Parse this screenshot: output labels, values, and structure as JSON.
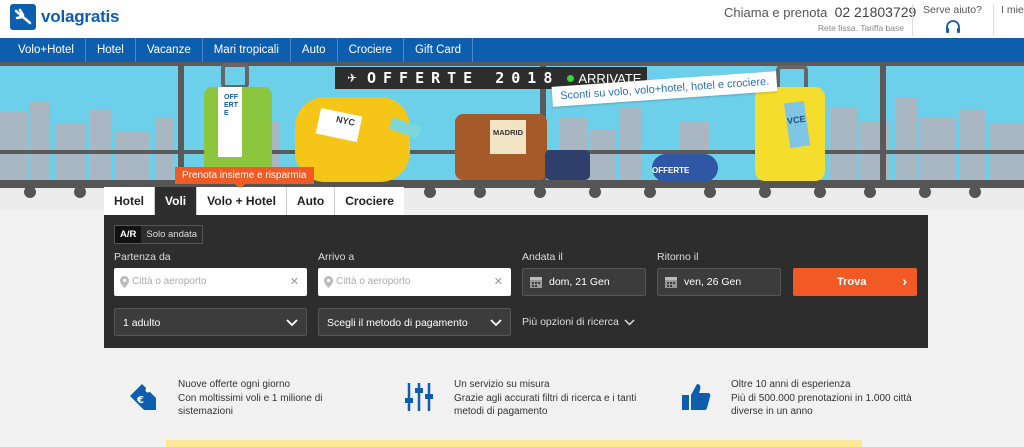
{
  "header": {
    "logo_text": "volagratis",
    "phone_label": "Chiama e prenota",
    "phone_number": "02 21803729",
    "phone_note": "Rete fissa. Tariffa base",
    "help_label": "Serve aiuto?",
    "my_label": "I miei"
  },
  "nav": {
    "items": [
      "Volo+Hotel",
      "Hotel",
      "Vacanze",
      "Mari tropicali",
      "Auto",
      "Crociere",
      "Gift Card"
    ]
  },
  "hero": {
    "board_text": "OFFERTE 2018",
    "board_status": "ARRIVATE",
    "promo_text": "Sconti su volo, volo+hotel, hotel e crociere.",
    "bag_tag": "OFFERTE",
    "suitcase_text": "OFFERTE",
    "tag_madrid": "MADRID",
    "tag_nyc": "NYC",
    "tag_vce": "VCE"
  },
  "search": {
    "badge": "Prenota insieme e risparmia",
    "tabs": [
      "Hotel",
      "Voli",
      "Volo + Hotel",
      "Auto",
      "Crociere"
    ],
    "active_tab": "Voli",
    "trip_types": [
      "A/R",
      "Solo andata"
    ],
    "departure_label": "Partenza da",
    "departure_placeholder": "Città o aeroporto",
    "arrival_label": "Arrivo a",
    "arrival_placeholder": "Città o aeroporto",
    "outbound_label": "Andata il",
    "outbound_value": "dom, 21 Gen",
    "return_label": "Ritorno il",
    "return_value": "ven, 26 Gen",
    "search_button": "Trova",
    "passengers": "1 adulto",
    "payment": "Scegli il metodo di pagamento",
    "more_options": "Più opzioni di ricerca"
  },
  "features": [
    {
      "line1": "Nuove offerte ogni giorno",
      "line2": "Con moltissimi voli e 1 milione di",
      "line3": "sistemazioni"
    },
    {
      "line1": "Un servizio su misura",
      "line2": "Grazie agli accurati filtri di ricerca e i tanti",
      "line3": "metodi di pagamento"
    },
    {
      "line1": "Oltre 10 anni di esperienza",
      "line2": "Più di 500.000 prenotazioni in 1.000 città",
      "line3": "diverse in un anno"
    }
  ],
  "colors": {
    "brand_blue": "#0d5eaf",
    "accent_orange": "#f15a24",
    "panel_dark": "#2d2d2d",
    "sky": "#6dd0ea"
  }
}
